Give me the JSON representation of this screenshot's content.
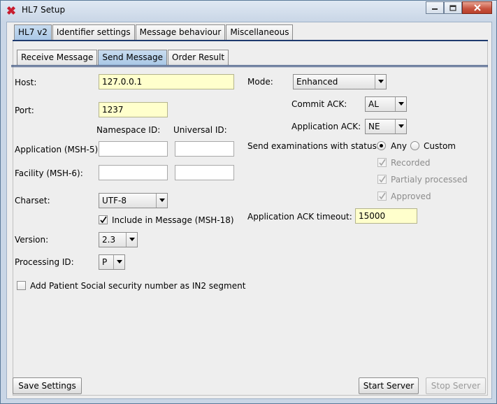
{
  "window": {
    "title": "HL7 Setup"
  },
  "tabs_main": [
    "HL7 v2",
    "Identifier settings",
    "Message behaviour",
    "Miscellaneous"
  ],
  "tabs_sub": [
    "Receive Message",
    "Send Message",
    "Order Result"
  ],
  "form": {
    "host_label": "Host:",
    "host_value": "127.0.0.1",
    "port_label": "Port:",
    "port_value": "1237",
    "namespace_header": "Namespace ID:",
    "universal_header": "Universal ID:",
    "application_label": "Application (MSH-5):",
    "application_ns": "",
    "application_uni": "",
    "facility_label": "Facility (MSH-6):",
    "facility_ns": "",
    "facility_uni": "",
    "charset_label": "Charset:",
    "charset_value": "UTF-8",
    "include_label": "Include in Message (MSH-18)",
    "version_label": "Version:",
    "version_value": "2.3",
    "processing_label": "Processing ID:",
    "processing_value": "P",
    "patient_ssn_label": "Add Patient Social security number as IN2 segment"
  },
  "right": {
    "mode_label": "Mode:",
    "mode_value": "Enhanced",
    "commit_label": "Commit ACK:",
    "commit_value": "AL",
    "appack_label": "Application ACK:",
    "appack_value": "NE",
    "send_status_label": "Send examinations with status:",
    "radio_any": "Any",
    "radio_custom": "Custom",
    "recorded": "Recorded",
    "partial": "Partialy processed",
    "approved": "Approved",
    "timeout_label": "Application ACK timeout:",
    "timeout_value": "15000"
  },
  "buttons": {
    "save": "Save Settings",
    "start": "Start Server",
    "stop": "Stop Server"
  },
  "colors": {
    "input_highlight": "#ffffcc",
    "active_tab": "#aac8e6",
    "close_button": "#c7523d"
  }
}
